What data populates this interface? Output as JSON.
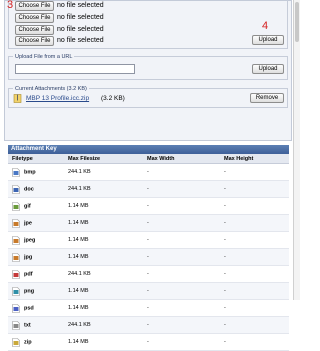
{
  "upload_files": {
    "step_marker": "3",
    "rows": [
      {
        "button": "Choose File",
        "status": "no file selected"
      },
      {
        "button": "Choose File",
        "status": "no file selected"
      },
      {
        "button": "Choose File",
        "status": "no file selected"
      },
      {
        "button": "Choose File",
        "status": "no file selected"
      }
    ],
    "upload_marker": "4",
    "upload_button": "Upload"
  },
  "upload_url": {
    "legend": "Upload File from a URL",
    "input_value": "",
    "upload_button": "Upload"
  },
  "attachments": {
    "legend": "Current Attachments (3.2 KB)",
    "items": [
      {
        "name": "MBP 13 Profile.icc.zip",
        "size": "(3.2 KB)",
        "icon": "zip-file-icon"
      }
    ],
    "remove_button": "Remove"
  },
  "attachment_key": {
    "title": "Attachment Key",
    "columns": [
      "Filetype",
      "Max Filesize",
      "Max Width",
      "Max Height"
    ],
    "rows": [
      {
        "type": "bmp",
        "size": "244.1 KB",
        "width": "-",
        "height": "-"
      },
      {
        "type": "doc",
        "size": "244.1 KB",
        "width": "-",
        "height": "-"
      },
      {
        "type": "gif",
        "size": "1.14 MB",
        "width": "-",
        "height": "-"
      },
      {
        "type": "jpe",
        "size": "1.14 MB",
        "width": "-",
        "height": "-"
      },
      {
        "type": "jpeg",
        "size": "1.14 MB",
        "width": "-",
        "height": "-"
      },
      {
        "type": "jpg",
        "size": "1.14 MB",
        "width": "-",
        "height": "-"
      },
      {
        "type": "pdf",
        "size": "244.1 KB",
        "width": "-",
        "height": "-"
      },
      {
        "type": "png",
        "size": "1.14 MB",
        "width": "-",
        "height": "-"
      },
      {
        "type": "psd",
        "size": "1.14 MB",
        "width": "-",
        "height": "-"
      },
      {
        "type": "txt",
        "size": "244.1 KB",
        "width": "-",
        "height": "-"
      },
      {
        "type": "zip",
        "size": "1.14 MB",
        "width": "-",
        "height": "-"
      }
    ]
  },
  "colors": {
    "accent_red": "#d42020",
    "header_blue": "#3d5f98",
    "link": "#2a4a8c"
  }
}
